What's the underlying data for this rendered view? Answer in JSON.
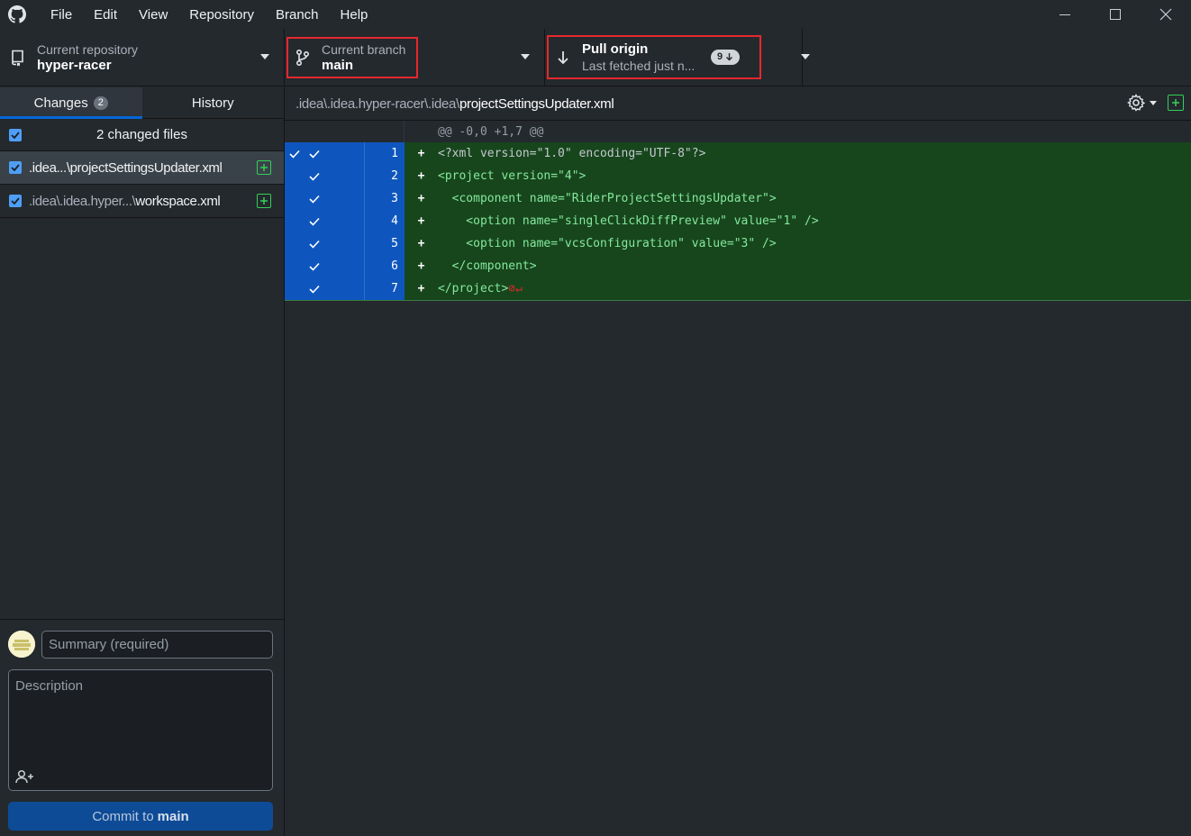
{
  "menu": [
    "File",
    "Edit",
    "View",
    "Repository",
    "Branch",
    "Help"
  ],
  "toolbar": {
    "repo_label": "Current repository",
    "repo_value": "hyper-racer",
    "branch_label": "Current branch",
    "branch_value": "main",
    "pull_title": "Pull origin",
    "pull_subtitle": "Last fetched just n...",
    "pull_badge": "9"
  },
  "tabs": {
    "changes_label": "Changes",
    "changes_count": "2",
    "history_label": "History"
  },
  "changes": {
    "header": "2 changed files",
    "files": [
      {
        "dir": ".idea...\\",
        "name": "projectSettingsUpdater.xml",
        "status": "added",
        "selected": true
      },
      {
        "dir": ".idea\\.idea.hyper...\\",
        "name": "workspace.xml",
        "status": "added",
        "selected": false
      }
    ]
  },
  "commit": {
    "summary_placeholder": "Summary (required)",
    "description_placeholder": "Description",
    "button_prefix": "Commit to",
    "button_branch": "main"
  },
  "diff": {
    "path_dir": ".idea\\.idea.hyper-racer\\.idea\\",
    "path_file": "projectSettingsUpdater.xml",
    "hunk": "@@ -0,0 +1,7 @@",
    "lines": [
      {
        "num": "1",
        "text": "<?xml version=\"1.0\" encoding=\"UTF-8\"?>"
      },
      {
        "num": "2",
        "text": "<project version=\"4\">"
      },
      {
        "num": "3",
        "text": "  <component name=\"RiderProjectSettingsUpdater\">"
      },
      {
        "num": "4",
        "text": "    <option name=\"singleClickDiffPreview\" value=\"1\" />"
      },
      {
        "num": "5",
        "text": "    <option name=\"vcsConfiguration\" value=\"3\" />"
      },
      {
        "num": "6",
        "text": "  </component>"
      },
      {
        "num": "7",
        "text": "</project>"
      }
    ]
  },
  "colors": {
    "accent": "#0366d6",
    "highlight_box": "#e5282e",
    "added_bg": "#17461d",
    "gutter_selected": "#0e56be",
    "commit_button": "#0e4b96"
  },
  "icons": {
    "app": "github-icon",
    "repo": "repo-icon",
    "branch": "git-branch-icon",
    "pull": "arrow-down-icon",
    "settings": "gear-icon",
    "expand": "diff-added-icon",
    "coauthor": "person-add-icon"
  }
}
